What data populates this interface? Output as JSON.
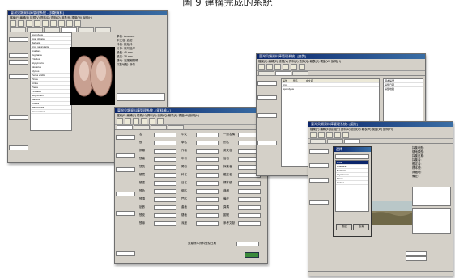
{
  "caption": "圖 9 建構完成的系統",
  "window1": {
    "title": "臺灣貝類資料庫管理系統 - [貝類資料]",
    "menu": "檔案(F)  編輯(E)  檢視(V)  資料(D)  查詢(Q)  報表(R)  視窗(W)  說明(H)",
    "tabs": [
      "基本資料",
      "分類資料",
      "形態描述",
      "棲地資料",
      "標本資料",
      "圖片"
    ],
    "species_list": [
      "Spondylus",
      "Acar plicata",
      "Barbatia",
      "Arca navicularis",
      "Anadara",
      "Tegillarca",
      "Trisidos",
      "Glycymeris",
      "Modiolus",
      "Mytilus",
      "Perna viridis",
      "Pinna",
      "Atrina",
      "Pteria",
      "Pinctada",
      "Isognomon",
      "Malleus",
      "Ostrea",
      "Saccostrea",
      "Crassostrea"
    ],
    "detail_lines": [
      "學名: Anadara",
      "中文名: 血蚶",
      "科名: 魷蛤科",
      "分佈: 臺灣沿岸",
      "殼長: 45 mm",
      "殼高: 38 mm",
      "棲地: 泥灘潮間帶",
      "採集地點: 新竹"
    ]
  },
  "window2": {
    "title": "臺灣貝類資料庫管理系統 - [資料輸入]",
    "fields_col1": [
      "名",
      "殼",
      "銅類",
      "殼高",
      "殼長",
      "殼寬",
      "殼重",
      "殼色",
      "殼頂",
      "肋數",
      "殼皮",
      "殼緣"
    ],
    "fields_col2": [
      "中文",
      "學名",
      "作者",
      "年份",
      "屬名",
      "科名",
      "目名",
      "綱名",
      "門名",
      "產地",
      "棲地",
      "深度"
    ],
    "fields_col3": [
      "一般名稱",
      "別名",
      "英文名",
      "俗名",
      "採集者",
      "鑑定者",
      "標本號",
      "典藏",
      "備註",
      "頁碼",
      "圖號",
      "參考文獻"
    ],
    "footer_label": "貝類標本資料登錄日期"
  },
  "window3": {
    "title": "臺灣貝類資料庫管理系統 - [查詢]",
    "header_cols": [
      "編號",
      "學名",
      "中文名"
    ],
    "rows": [
      "Arca",
      "Spondylus"
    ],
    "side_lines": [
      "標本編號",
      "採集日期",
      "採集地點"
    ]
  },
  "window4": {
    "title": "臺灣貝類資料庫管理系統 - [圖片]",
    "dialog_title": "選擇",
    "dialog_items": [
      "Arca",
      "Anadara",
      "Barbatia",
      "Glycymeris",
      "Pinna",
      "Ostrea"
    ],
    "detail_lines": [
      "採集地點:",
      "棲地類型:",
      "採集日期:",
      "採集者:",
      "鑑定者:",
      "標本號:",
      "典藏地:",
      "備註:"
    ],
    "buttons": {
      "ok": "確定",
      "cancel": "取消"
    }
  },
  "colors": {
    "title_bar": "#0a246a",
    "window_bg": "#d4d0c8",
    "label_bg": "#0a246a",
    "shell": "#c8a091"
  }
}
